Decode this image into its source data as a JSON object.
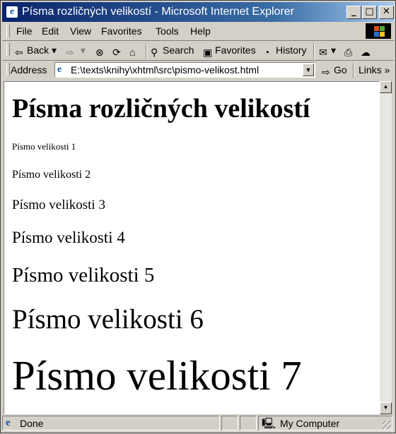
{
  "window": {
    "title": "Písma rozličných velikostí - Microsoft Internet Explorer",
    "minimize": "_",
    "maximize": "□",
    "close": "✕"
  },
  "menu": [
    "File",
    "Edit",
    "View",
    "Favorites",
    "Tools",
    "Help"
  ],
  "toolbar": {
    "back": "Back",
    "forward": "",
    "search": "Search",
    "favorites": "Favorites",
    "history": "History"
  },
  "address": {
    "label": "Address",
    "value": "E:\\texts\\knihy\\xhtml\\src\\pismo-velikost.html",
    "go": "Go",
    "links": "Links"
  },
  "page": {
    "heading": "Písma rozličných velikostí",
    "lines": [
      "Písmo velikosti 1",
      "Písmo velikosti 2",
      "Písmo velikosti 3",
      "Písmo velikosti 4",
      "Písmo velikosti 5",
      "Písmo velikosti 6",
      "Písmo velikosti 7"
    ]
  },
  "status": {
    "text": "Done",
    "zone": "My Computer"
  }
}
